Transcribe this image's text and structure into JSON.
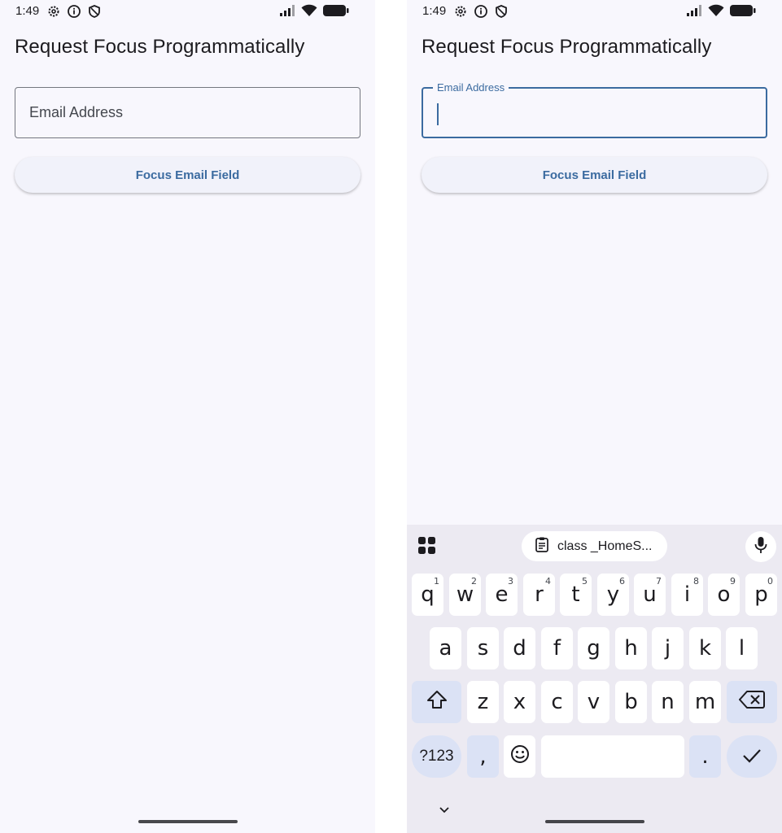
{
  "status_bar": {
    "time": "1:49"
  },
  "app": {
    "title": "Request Focus Programmatically"
  },
  "left_screen": {
    "email_field": {
      "placeholder": "Email Address"
    },
    "focus_button": {
      "label": "Focus Email Field"
    }
  },
  "right_screen": {
    "email_field": {
      "label": "Email Address",
      "value": ""
    },
    "focus_button": {
      "label": "Focus Email Field"
    }
  },
  "keyboard": {
    "clipboard_suggestion": "class _HomeS...",
    "row1": [
      {
        "key": "q",
        "num": "1"
      },
      {
        "key": "w",
        "num": "2"
      },
      {
        "key": "e",
        "num": "3"
      },
      {
        "key": "r",
        "num": "4"
      },
      {
        "key": "t",
        "num": "5"
      },
      {
        "key": "y",
        "num": "6"
      },
      {
        "key": "u",
        "num": "7"
      },
      {
        "key": "i",
        "num": "8"
      },
      {
        "key": "o",
        "num": "9"
      },
      {
        "key": "p",
        "num": "0"
      }
    ],
    "row2": [
      "a",
      "s",
      "d",
      "f",
      "g",
      "h",
      "j",
      "k",
      "l"
    ],
    "row3": [
      "z",
      "x",
      "c",
      "v",
      "b",
      "n",
      "m"
    ],
    "symbols_key": "?123",
    "comma_key": ",",
    "period_key": "."
  },
  "colors": {
    "primary": "#3b6ba0",
    "background": "#f8f7fd",
    "keyboard_bg": "#eceaf2",
    "modifier_key": "#dbe2f5"
  }
}
